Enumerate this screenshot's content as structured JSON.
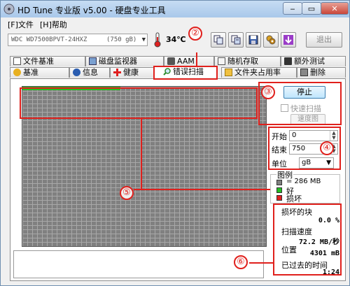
{
  "window": {
    "title": "HD Tune 专业版 v5.00 - 硬盘专业工具",
    "buttons": {
      "minimize": "‒",
      "maximize": "▭",
      "close": "✕"
    }
  },
  "menu": [
    {
      "label": "[F]文件"
    },
    {
      "label": "[H]帮助"
    }
  ],
  "toolbar": {
    "drive_name": "WDC WD7500BPVT-24HXZ",
    "drive_capacity": "(750 gB)",
    "temperature": "34℃",
    "exit_label": "退出",
    "icons": [
      "copy-icon",
      "copy-all-icon",
      "save-icon",
      "options-icon",
      "download-icon"
    ]
  },
  "tabs": {
    "row1": [
      {
        "label": "文件基准",
        "icon": "file-benchmark-icon"
      },
      {
        "label": "磁盘监视器",
        "icon": "disk-monitor-icon"
      },
      {
        "label": "AAM",
        "icon": "speaker-icon"
      },
      {
        "label": "随机存取",
        "icon": "random-access-icon"
      },
      {
        "label": "额外测试",
        "icon": "extra-tests-icon"
      }
    ],
    "row2": [
      {
        "label": "基准",
        "icon": "benchmark-icon"
      },
      {
        "label": "信息",
        "icon": "info-icon"
      },
      {
        "label": "健康",
        "icon": "health-icon"
      },
      {
        "label": "错误扫描",
        "icon": "magnifier-icon",
        "active": true
      },
      {
        "label": "文件夹占用率",
        "icon": "folder-icon"
      },
      {
        "label": "删除",
        "icon": "trash-icon"
      }
    ]
  },
  "scan": {
    "stop_label": "停止",
    "quick_scan_label": "快速扫描",
    "speed_map_label": "速度图",
    "start_label": "开始",
    "start_value": "0",
    "end_label": "结束",
    "end_value": "750",
    "unit_label": "单位",
    "unit_value": "gB"
  },
  "legend": {
    "title": "图例",
    "block_size": "= 286 MB",
    "good_label": "好",
    "bad_label": "损坏",
    "colors": {
      "block": "#808080",
      "good": "#22c022",
      "bad": "#e02020"
    }
  },
  "stats": {
    "damaged_label": "损坏的块",
    "damaged_value": "0.0 %",
    "speed_label": "扫描速度",
    "speed_value": "72.2 MB/秒",
    "position_label": "位置",
    "position_value": "4301 mB",
    "elapsed_label": "已过去的时间",
    "elapsed_value": "1:24"
  },
  "annotations": [
    "②",
    "③",
    "④",
    "⑤",
    "⑥"
  ]
}
